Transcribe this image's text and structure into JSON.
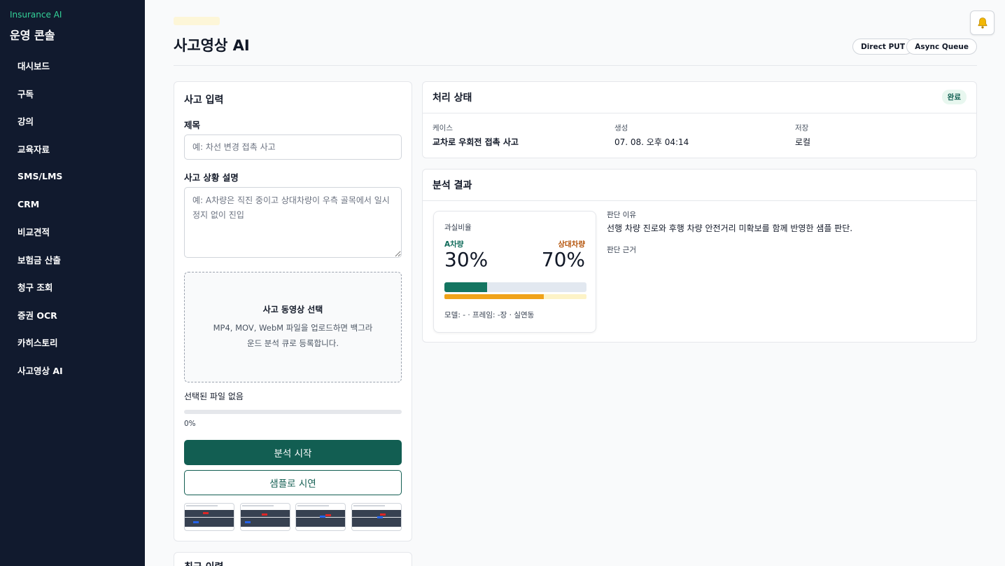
{
  "sidebar": {
    "brand_small": "Insurance AI",
    "brand_big": "운영 콘솔",
    "items": [
      {
        "label": "대시보드"
      },
      {
        "label": "구독"
      },
      {
        "label": "강의"
      },
      {
        "label": "교육자료"
      },
      {
        "label": "SMS/LMS"
      },
      {
        "label": "CRM"
      },
      {
        "label": "비교견적"
      },
      {
        "label": "보험금 산출"
      },
      {
        "label": "청구 조회"
      },
      {
        "label": "증권 OCR"
      },
      {
        "label": "카히스토리"
      },
      {
        "label": "사고영상 AI"
      }
    ]
  },
  "header": {
    "title": "사고영상 AI",
    "pill_put": "Direct PUT",
    "pill_async": "Async Queue",
    "bell_icon": "bell-icon"
  },
  "input_card": {
    "title": "사고 입력",
    "title_label": "제목",
    "title_placeholder": "예: 차선 변경 접촉 사고",
    "desc_label": "사고 상황 설명",
    "desc_placeholder": "예: A차량은 직진 중이고 상대차량이 우측 골목에서 일시정지 없이 진입",
    "dropzone_title": "사고 동영상 선택",
    "dropzone_desc": "MP4, MOV, WebM 파일을 업로드하면 백그라운드 분석 큐로 등록합니다.",
    "file_status": "선택된 파일 없음",
    "progress": 0,
    "progress_text": "0%",
    "analyze_button": "분석 시작",
    "sample_button": "샘플로 시연"
  },
  "history_card": {
    "title": "최근 이력"
  },
  "status_card": {
    "title": "처리 상태",
    "badge": "완료",
    "case_label": "케이스",
    "case_value": "교차로 우회전 접촉 사고",
    "created_label": "생성",
    "created_value": "07. 08. 오후 04:14",
    "storage_label": "저장",
    "storage_value": "로컬"
  },
  "result_card": {
    "title": "분석 결과",
    "fault_title": "과실비율",
    "a_label": "A차량",
    "b_label": "상대차량",
    "a_percent": 30,
    "b_percent": 70,
    "a_value": "30%",
    "b_value": "70%",
    "footer": "모델: - · 프레임: -장 · 실연동",
    "reason_label": "판단 이유",
    "reason_text": "선행 차량 진로와 후행 차량 안전거리 미확보를 함께 반영한 샘플 판단.",
    "basis_label": "판단 근거"
  },
  "colors": {
    "sidebar_bg": "#111a2e",
    "brand_accent": "#34d399",
    "primary": "#125e52",
    "a_bar": "#147561",
    "b_bar": "#f0a31a"
  }
}
